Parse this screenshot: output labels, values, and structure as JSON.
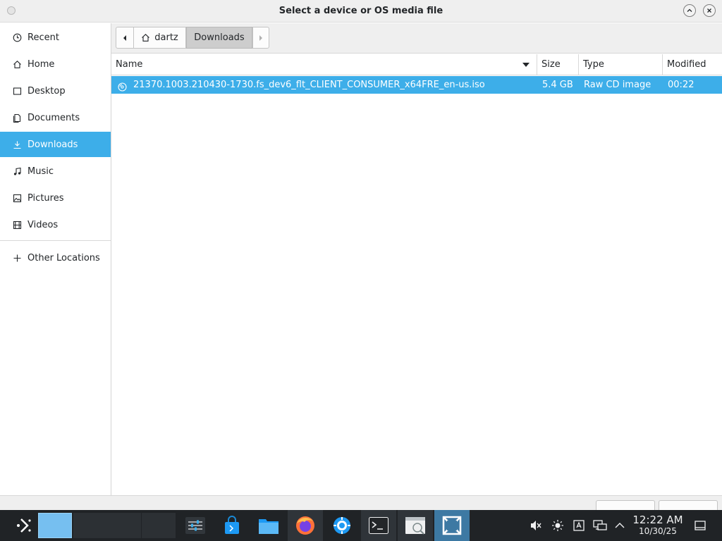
{
  "window": {
    "title": "Select a device or OS media file"
  },
  "sidebar": {
    "items": [
      {
        "label": "Recent",
        "icon": "clock-icon"
      },
      {
        "label": "Home",
        "icon": "home-icon"
      },
      {
        "label": "Desktop",
        "icon": "desktop-icon"
      },
      {
        "label": "Documents",
        "icon": "documents-icon"
      },
      {
        "label": "Downloads",
        "icon": "download-icon",
        "active": true
      },
      {
        "label": "Music",
        "icon": "music-icon"
      },
      {
        "label": "Pictures",
        "icon": "pictures-icon"
      },
      {
        "label": "Videos",
        "icon": "videos-icon"
      }
    ],
    "other_locations": {
      "label": "Other Locations",
      "icon": "plus-icon"
    }
  },
  "pathbar": {
    "segments": [
      {
        "label": "dartz",
        "icon": "home-icon"
      },
      {
        "label": "Downloads",
        "active": true
      }
    ]
  },
  "filelist": {
    "columns": {
      "name": "Name",
      "size": "Size",
      "type": "Type",
      "modified": "Modified"
    },
    "sort": {
      "column": "name",
      "direction": "descending"
    },
    "rows": [
      {
        "name": "21370.1003.210430-1730.fs_dev6_flt_CLIENT_CONSUMER_x64FRE_en-us.iso",
        "size": "5.4 GB",
        "type": "Raw CD image",
        "modified": "00:22",
        "icon": "disc-image-icon",
        "selected": true
      }
    ]
  },
  "taskbar": {
    "virtual_desktops": 4,
    "active_desktop": 1,
    "apps": [
      "settings-sliders-icon",
      "store-icon",
      "file-manager-icon",
      "firefox-icon",
      "system-settings-icon",
      "terminal-icon",
      "disk-image-writer-icon",
      "kde-connect-icon"
    ],
    "clock": {
      "time": "12:22 AM",
      "date": "10/30/25"
    }
  },
  "colors": {
    "accent": "#3daee9",
    "taskbar_bg": "#202326",
    "window_bg": "#efefef"
  }
}
